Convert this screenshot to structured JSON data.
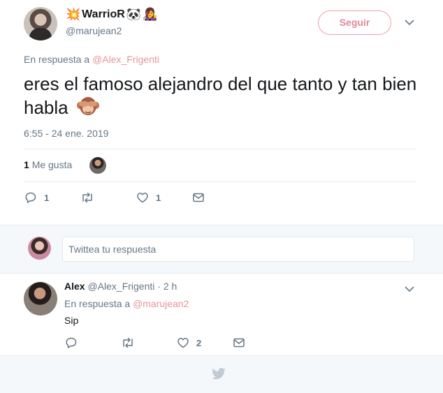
{
  "main_tweet": {
    "display_name": "WarrioR",
    "name_emojis": [
      "💥",
      "🐼",
      "👩‍🎤"
    ],
    "handle": "@marujean2",
    "follow_label": "Seguir",
    "reply_prefix": "En respuesta a",
    "reply_mention": "@Alex_Frigenti",
    "text": "eres el famoso alejandro del que tanto y tan bien habla",
    "text_emoji": "🙈",
    "timestamp": "6:55 - 24 ene. 2019",
    "likes_count": "1",
    "likes_label": "Me gusta",
    "actions": {
      "reply_count": "1",
      "retweet_count": "",
      "like_count": "1"
    }
  },
  "compose": {
    "placeholder": "Twittea tu respuesta"
  },
  "reply_tweet": {
    "display_name": "Alex",
    "handle": "@Alex_Frigenti",
    "time": "· 2 h",
    "reply_prefix": "En respuesta a",
    "reply_mention": "@marujean2",
    "text": "Sip",
    "actions": {
      "reply_count": "",
      "retweet_count": "",
      "like_count": "2"
    }
  },
  "colors": {
    "accent": "#e08a94",
    "muted": "#657786",
    "text": "#14171a",
    "band": "#f5f8fa"
  }
}
